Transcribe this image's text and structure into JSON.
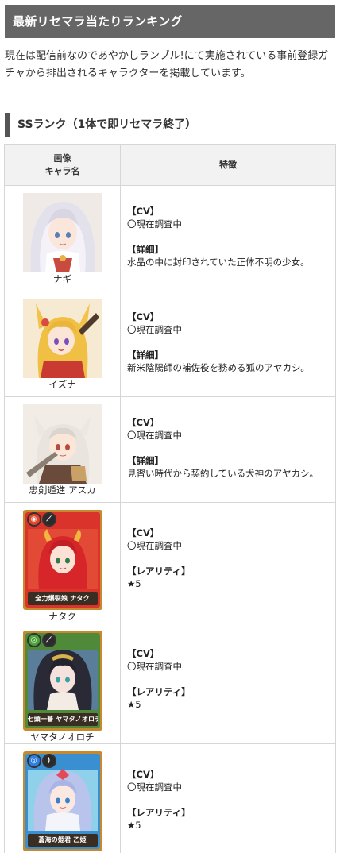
{
  "heading": "最新リセマラ当たりランキング",
  "intro": "現在は配信前なのであやかしランブル!にて実施されている事前登録ガチャから排出されるキャラクターを掲載しています。",
  "section_title": "SSランク（1体で即リセマラ終了）",
  "table": {
    "col1_header_line1": "画像",
    "col1_header_line2": "キャラ名",
    "col2_header": "特徴",
    "rows": [
      {
        "name": "ナギ",
        "cv_label": "【CV】",
        "cv_value": "〇現在調査中",
        "detail_label": "【詳細】",
        "detail_value": "水晶の中に封印されていた正体不明の少女。",
        "art": "portrait-nagi"
      },
      {
        "name": "イズナ",
        "cv_label": "【CV】",
        "cv_value": "〇現在調査中",
        "detail_label": "【詳細】",
        "detail_value": "新米陰陽師の補佐役を務める狐のアヤカシ。",
        "art": "portrait-izuna"
      },
      {
        "name": "忠剣遁進 アスカ",
        "cv_label": "【CV】",
        "cv_value": "〇現在調査中",
        "detail_label": "【詳細】",
        "detail_value": "見習い時代から契約している犬神のアヤカシ。",
        "art": "portrait-asuka"
      },
      {
        "name": "ナタク",
        "cv_label": "【CV】",
        "cv_value": "〇現在調査中",
        "detail_label": "【レアリティ】",
        "detail_value": "★5",
        "card_plate": "全力爆裂娘 ナタク",
        "art": "card-nataku"
      },
      {
        "name": "ヤマタノオロチ",
        "cv_label": "【CV】",
        "cv_value": "〇現在調査中",
        "detail_label": "【レアリティ】",
        "detail_value": "★5",
        "card_plate": "七頭一蕃 ヤマタノオロチ",
        "art": "card-yamata"
      },
      {
        "name": "乙姫",
        "cv_label": "【CV】",
        "cv_value": "〇現在調査中",
        "detail_label": "【レアリティ】",
        "detail_value": "★5",
        "card_plate": "蒼海の姫君 乙姫",
        "art": "card-otohime"
      }
    ]
  },
  "colors": {
    "heading_bg": "#666666",
    "header_cell_bg": "#f2f2f2",
    "border": "#d6d6d6"
  }
}
